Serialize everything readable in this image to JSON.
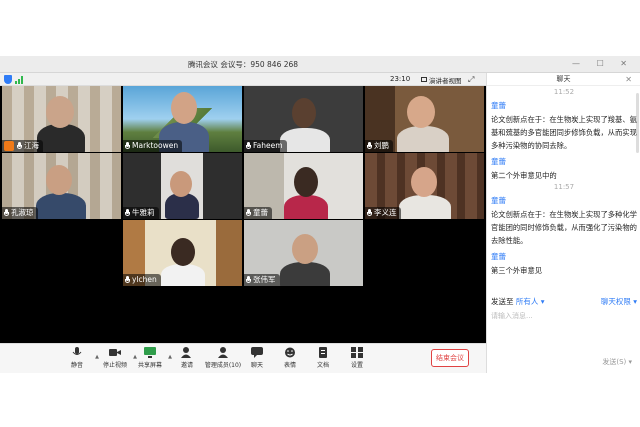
{
  "window": {
    "title": "腾讯会议 会议号：950 846 268",
    "controls": "— ☐ ✕"
  },
  "status": {
    "timer": "23:10",
    "speaker_view": "演讲者视图"
  },
  "participants": [
    {
      "name": "江海",
      "host": true
    },
    {
      "name": "Marktoowen"
    },
    {
      "name": "Faheem"
    },
    {
      "name": "刘鹏"
    },
    {
      "name": "孔淑琼"
    },
    {
      "name": "牛雅莉"
    },
    {
      "name": "童蕾"
    },
    {
      "name": "李义连"
    },
    {
      "name": "ylchen"
    },
    {
      "name": "张伟军"
    }
  ],
  "toolbar": {
    "mute": "静音",
    "stop_video": "停止视频",
    "share": "共享屏幕",
    "invite": "邀请",
    "members": "管理成员(10)",
    "chat": "聊天",
    "reactions": "表情",
    "docs": "文档",
    "settings": "设置",
    "end": "结束会议"
  },
  "chat": {
    "title": "聊天",
    "timestamp1": "11:52",
    "msg1_sender": "童蕾",
    "msg1_text": "论文创新点在于：在生物炭上实现了羧基、氨基和巯基的多官能团同步修饰负载，从而实现多种污染物的协同去除。",
    "msg2_sender": "童蕾",
    "msg2_text": "第二个外审意见中的",
    "timestamp2": "11:57",
    "msg3_sender": "童蕾",
    "msg3_text": "论文创新点在于：在生物炭上实现了多种化学官能团的同时修饰负载，从而强化了污染物的去除性能。",
    "msg4_sender": "童蕾",
    "msg4_text": "第三个外审意见",
    "send_to_label": "发送至",
    "recipient": "所有人",
    "permission": "聊天权限",
    "input_placeholder": "请输入消息...",
    "send": "发送(S)"
  },
  "colors": {
    "accent": "#2f7cf6",
    "end": "#e04343",
    "host_badge": "#f07a18"
  }
}
